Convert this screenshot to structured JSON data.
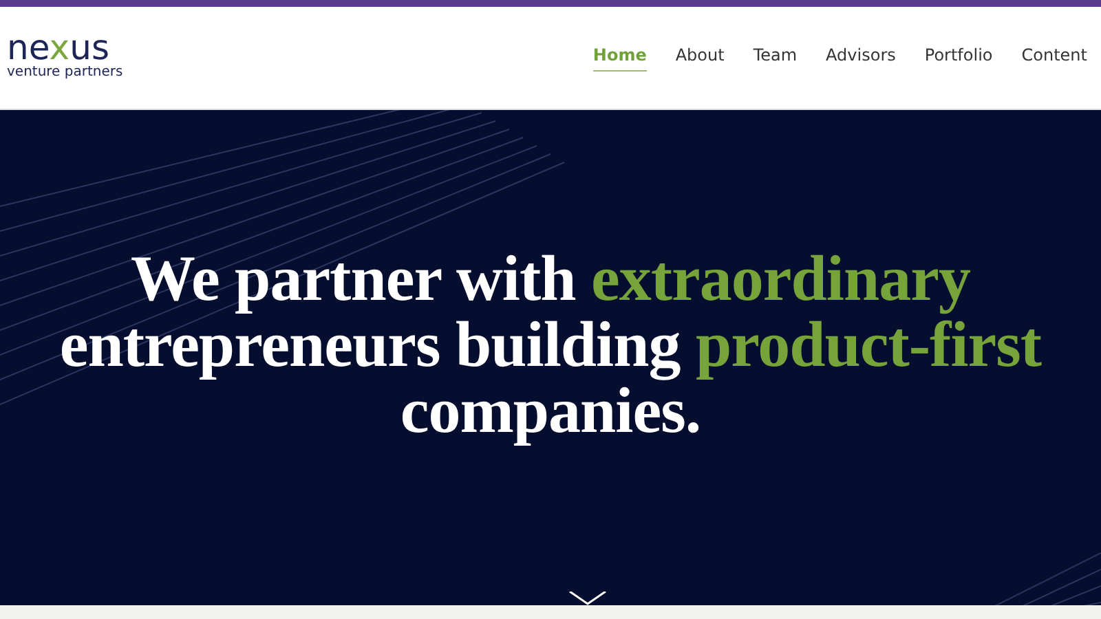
{
  "logo": {
    "wordmark": [
      {
        "text": "ne",
        "accent": false
      },
      {
        "text": "x",
        "accent": true
      },
      {
        "text": "us",
        "accent": false
      }
    ],
    "tagline": "venture partners"
  },
  "nav": [
    {
      "label": "Home",
      "selected": true
    },
    {
      "label": "About",
      "selected": false
    },
    {
      "label": "Team",
      "selected": false
    },
    {
      "label": "Advisors",
      "selected": false
    },
    {
      "label": "Portfolio",
      "selected": false
    },
    {
      "label": "Content",
      "selected": false
    }
  ],
  "hero": {
    "headline": [
      [
        {
          "text": "We partner with ",
          "accent": false
        },
        {
          "text": "extraordinary",
          "accent": true
        }
      ],
      [
        {
          "text": "entrepreneurs building ",
          "accent": false
        },
        {
          "text": "product-first",
          "accent": true
        }
      ],
      [
        {
          "text": "companies.",
          "accent": false
        }
      ]
    ]
  }
}
